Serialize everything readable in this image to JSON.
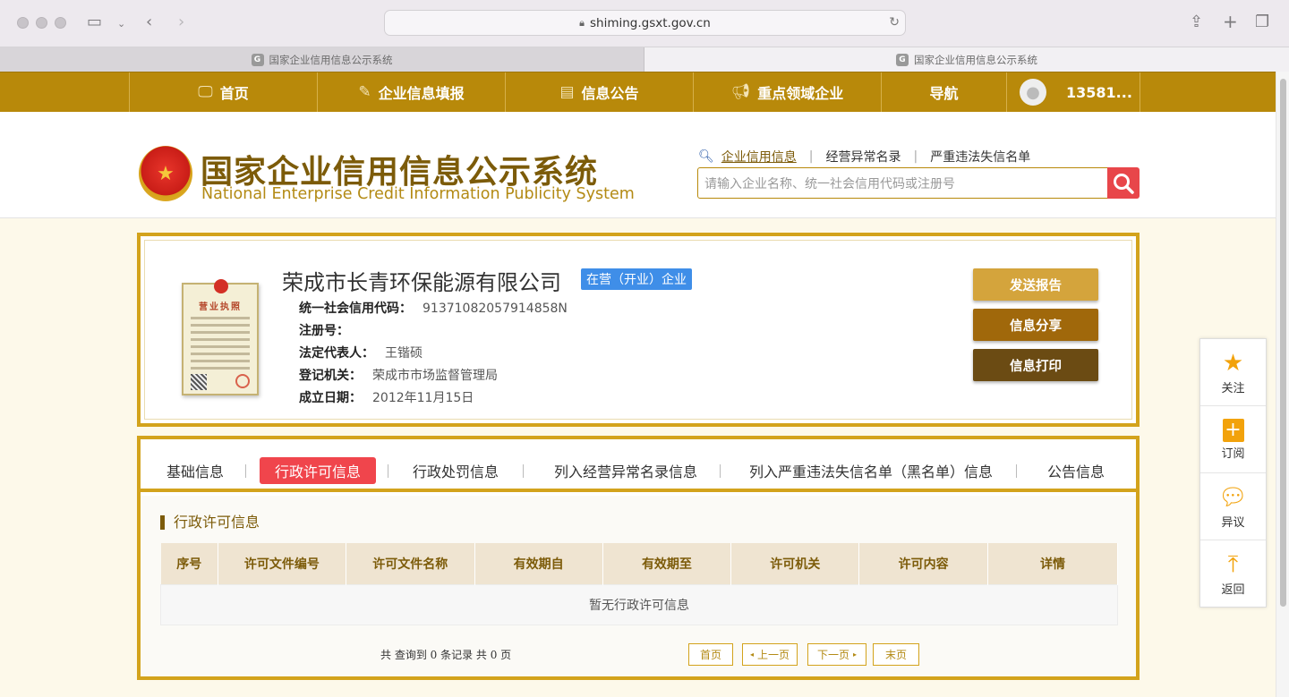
{
  "browser": {
    "url": "shiming.gsxt.gov.cn",
    "tabs": [
      {
        "label": "国家企业信用信息公示系统",
        "active": true
      },
      {
        "label": "国家企业信用信息公示系统",
        "active": false
      }
    ],
    "favicon_letter": "G"
  },
  "nav": {
    "items": [
      {
        "label": "首页",
        "icon": "monitor-icon"
      },
      {
        "label": "企业信息填报",
        "icon": "pen-icon"
      },
      {
        "label": "信息公告",
        "icon": "document-icon"
      },
      {
        "label": "重点领域企业",
        "icon": "megaphone-icon"
      },
      {
        "label": "导航",
        "icon": ""
      }
    ],
    "user": "13581..."
  },
  "header": {
    "title_cn": "国家企业信用信息公示系统",
    "title_en": "National Enterprise Credit Information Publicity System",
    "search_links": [
      "企业信用信息",
      "经营异常名录",
      "严重违法失信名单"
    ],
    "search_placeholder": "请输入企业名称、统一社会信用代码或注册号"
  },
  "company": {
    "name": "荣成市长青环保能源有限公司",
    "status": "在营（开业）企业",
    "fields": [
      {
        "label": "统一社会信用代码：",
        "value": "91371082057914858N"
      },
      {
        "label": "注册号：",
        "value": ""
      },
      {
        "label": "法定代表人：",
        "value": "王锴硕"
      },
      {
        "label": "登记机关：",
        "value": "荣成市市场监督管理局"
      },
      {
        "label": "成立日期：",
        "value": "2012年11月15日"
      }
    ],
    "license_title": "营业执照",
    "actions": [
      {
        "label": "发送报告",
        "color": "#d4a43c"
      },
      {
        "label": "信息分享",
        "color": "#a0680b"
      },
      {
        "label": "信息打印",
        "color": "#6b4b13"
      }
    ]
  },
  "tabs": {
    "items": [
      "基础信息",
      "行政许可信息",
      "行政处罚信息",
      "列入经营异常名录信息",
      "列入严重违法失信名单（黑名单）信息",
      "公告信息"
    ],
    "active_index": 1
  },
  "section": {
    "title": "行政许可信息",
    "columns": [
      "序号",
      "许可文件编号",
      "许可文件名称",
      "有效期自",
      "有效期至",
      "许可机关",
      "许可内容",
      "详情"
    ],
    "empty_text": "暂无行政许可信息",
    "pager_info": "共 查询到 0 条记录 共 0 页",
    "pager": {
      "first": "首页",
      "prev": "上一页",
      "next": "下一页",
      "last": "末页"
    }
  },
  "floatbar": [
    {
      "label": "关注",
      "icon": "star-icon"
    },
    {
      "label": "订阅",
      "icon": "subscribe-plus-icon"
    },
    {
      "label": "异议",
      "icon": "chat-bubble-icon"
    },
    {
      "label": "返回",
      "icon": "back-to-top-icon"
    }
  ],
  "colors": {
    "nav_bg": "#b8890a",
    "brand_brown": "#7c5b09",
    "frame_gold": "#d3a31c",
    "active_tab": "#f0454c",
    "status_blue": "#3f8ee8",
    "search_red": "#e8464a"
  }
}
